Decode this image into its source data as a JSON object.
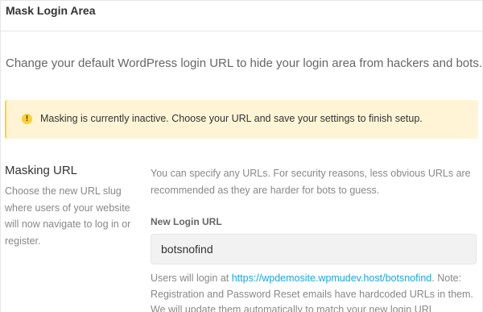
{
  "header": {
    "title": "Mask Login Area"
  },
  "intro": {
    "text": "Change your default WordPress login URL to hide your login area from hackers and bots."
  },
  "notice": {
    "icon": "exclamation-icon",
    "text": "Masking is currently inactive. Choose your URL and save your settings to finish setup.",
    "color": "#fecf2f",
    "background": "#fff5d6"
  },
  "masking": {
    "title": "Masking URL",
    "description": "Choose the new URL slug where users of your website will now navigate to log in or register.",
    "hint": "You can specify any URLs. For security reasons, less obvious URLs are recommended as they are harder for bots to guess.",
    "field_label": "New Login URL",
    "field_value": "botsnofind",
    "help_prefix": "Users will login at ",
    "help_link": "https://wpdemosite.wpmudev.host/botsnofind",
    "help_suffix": ". Note: Registration and Password Reset emails have hardcoded URLs in them. We will update them automatically to match your new login URL",
    "link_color": "#17a8e3"
  }
}
